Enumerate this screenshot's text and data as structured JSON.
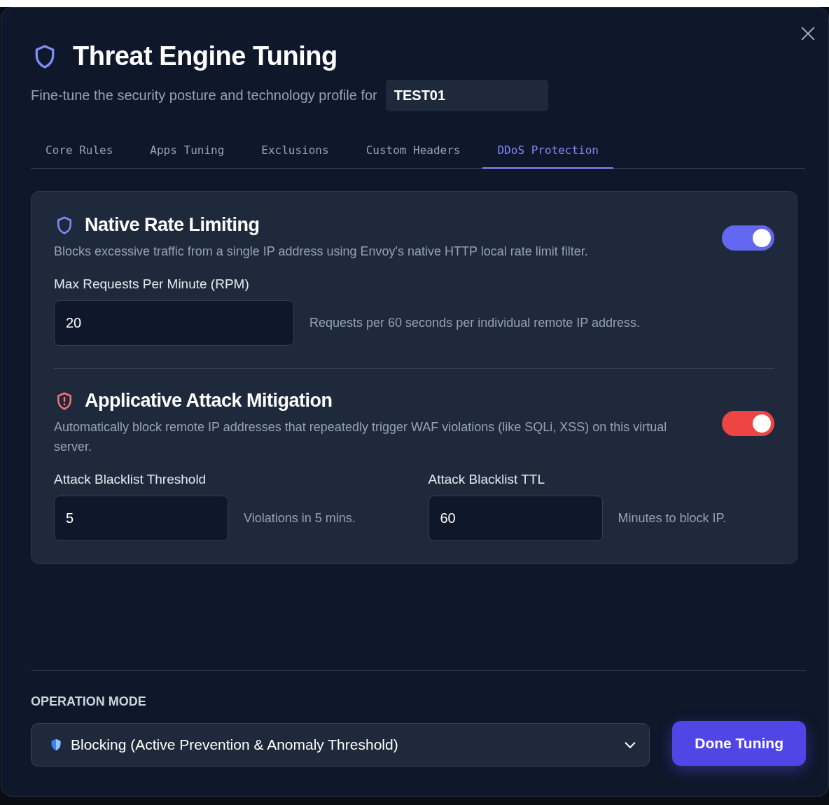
{
  "dialog": {
    "title": "Threat Engine Tuning",
    "subtitle": "Fine-tune the security posture and technology profile for",
    "target": "TEST01"
  },
  "tabs": [
    {
      "label": "Core Rules",
      "selected": false
    },
    {
      "label": "Apps Tuning",
      "selected": false
    },
    {
      "label": "Exclusions",
      "selected": false
    },
    {
      "label": "Custom Headers",
      "selected": false
    },
    {
      "label": "DDoS Protection",
      "selected": true
    }
  ],
  "sections": [
    {
      "kind": "rate_limit",
      "color": "#6366f1",
      "title": "Native Rate Limiting",
      "description": "Blocks excessive traffic from a single IP address using Envoy's native HTTP local rate limit filter.",
      "on": true,
      "fields": [
        {
          "label": "Max Requests Per Minute (RPM)",
          "value": "20",
          "hint": "Requests per 60 seconds per individual remote IP address."
        }
      ]
    },
    {
      "kind": "attack",
      "color": "#ef4444",
      "title": "Applicative Attack Mitigation",
      "description": "Automatically block remote IP addresses that repeatedly trigger WAF violations (like SQLi, XSS) on this virtual server.",
      "on": true,
      "fields": [
        {
          "label": "Attack Blacklist Threshold",
          "value": "5",
          "hint": "Violations in 5 mins."
        },
        {
          "label": "Attack Blacklist TTL",
          "value": "60",
          "hint": "Minutes to block IP."
        }
      ]
    }
  ],
  "footer": {
    "label": "OPERATION MODE",
    "mode": "Blocking (Active Prevention & Anomaly Threshold)",
    "button": "Done Tuning"
  }
}
